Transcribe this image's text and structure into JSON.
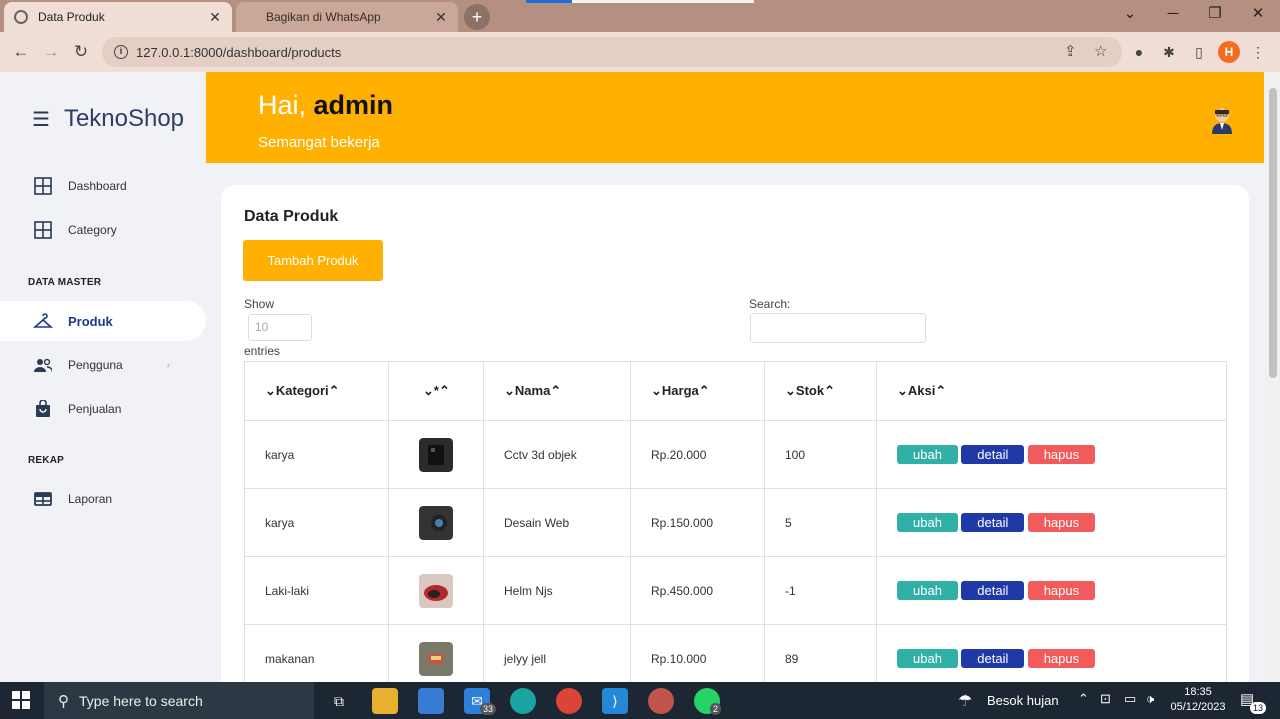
{
  "browser": {
    "tabs": [
      {
        "title": "Data Produk",
        "active": true
      },
      {
        "title": "Bagikan di WhatsApp",
        "active": false
      }
    ],
    "url": "127.0.0.1:8000/dashboard/products",
    "profile_initial": "H"
  },
  "sidebar": {
    "brand": "TeknoShop",
    "items": [
      {
        "label": "Dashboard",
        "icon": "grid-icon"
      },
      {
        "label": "Category",
        "icon": "grid-icon"
      }
    ],
    "section_master": "DATA MASTER",
    "master_items": [
      {
        "label": "Produk",
        "icon": "hanger-icon",
        "active": true
      },
      {
        "label": "Pengguna",
        "icon": "users-icon"
      },
      {
        "label": "Penjualan",
        "icon": "shopping-bag-icon"
      }
    ],
    "section_rekap": "REKAP",
    "rekap_items": [
      {
        "label": "Laporan",
        "icon": "table-icon"
      }
    ]
  },
  "header": {
    "greeting_prefix": "Hai,",
    "username": "admin",
    "subtitle": "Semangat bekerja"
  },
  "content": {
    "title": "Data Produk",
    "add_button": "Tambah Produk",
    "show_label": "Show",
    "entries_label": "entries",
    "page_length_placeholder": "10",
    "search_label": "Search:",
    "columns": [
      "Kategori",
      "*",
      "Nama",
      "Harga",
      "Stok",
      "Aksi"
    ],
    "rows": [
      {
        "kategori": "karya",
        "nama": "Cctv 3d objek",
        "harga": "Rp.20.000",
        "stok": "100"
      },
      {
        "kategori": "karya",
        "nama": "Desain Web",
        "harga": "Rp.150.000",
        "stok": "5"
      },
      {
        "kategori": "Laki-laki",
        "nama": "Helm Njs",
        "harga": "Rp.450.000",
        "stok": "-1"
      },
      {
        "kategori": "makanan",
        "nama": "jelyy jell",
        "harga": "Rp.10.000",
        "stok": "89"
      }
    ],
    "actions": {
      "edit": "ubah",
      "detail": "detail",
      "delete": "hapus"
    }
  },
  "taskbar": {
    "search_placeholder": "Type here to search",
    "mail_badge": "33",
    "whatsapp_badge": "2",
    "weather": "Besok hujan",
    "time": "18:35",
    "date": "05/12/2023",
    "notification_count": "13"
  },
  "colors": {
    "accent": "#ffb000",
    "brand": "#2e3e66",
    "ubah": "#31b0a8",
    "detail": "#1f3aa6",
    "hapus": "#f25b5b"
  }
}
